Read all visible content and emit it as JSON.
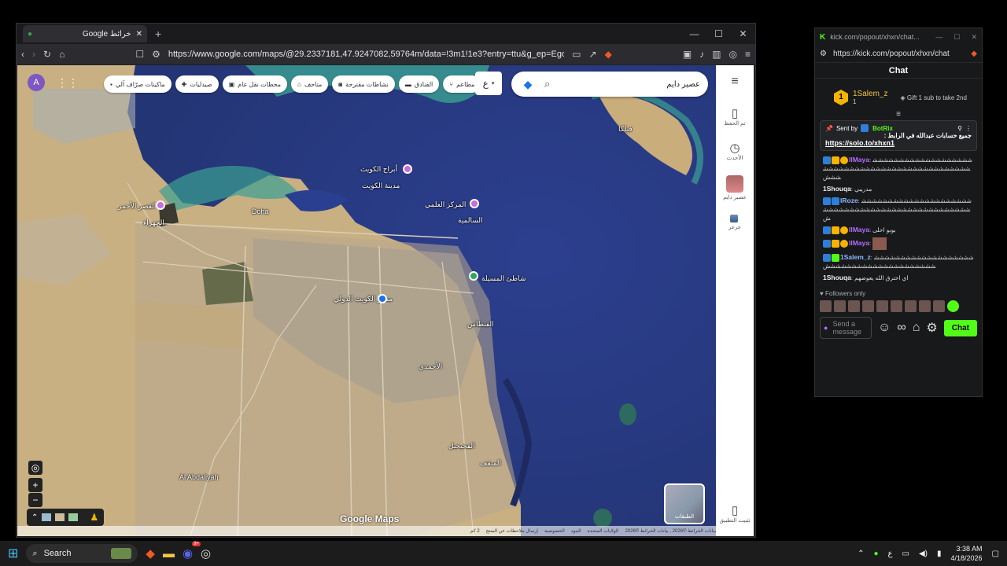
{
  "browser": {
    "tab_title": "Google خرائط",
    "tab_close": "✕",
    "new_tab": "+",
    "win_min": "—",
    "win_max": "☐",
    "win_close": "✕",
    "url": "https://www.google.com/maps/@29.2337181,47.9247082,59764m/data=!3m1!1e3?entry=ttu&g_ep=EgoyMDI2MD..."
  },
  "map": {
    "search_text": "عصير دايم",
    "keyboard_label": "ع",
    "avatar_letter": "A",
    "chips": [
      "مطاعم",
      "الفنادق",
      "نشاطات مقترحة",
      "متاحف",
      "محطات نقل عام",
      "صيدليات",
      "ماكينات صرّاف آلي"
    ],
    "side": {
      "saved": "تم الحفظ",
      "recent": "الأحدث",
      "place1": "عصير دايم",
      "place2": "عرعر",
      "app": "تثبيت التطبيق"
    },
    "layers_label": "الطبقات",
    "logo": "Google Maps",
    "footer": [
      "بيانات الخرائط ©2026 , بيانات الخرائط ©2026",
      "الولايات المتحدة",
      "البنود",
      "الخصوصية",
      "إرسال ملاحظات عن المنتج",
      "2 كم"
    ],
    "labels": {
      "kuwait_towers": "أبراج الكويت",
      "kuwait_city": "مدينة الكويت",
      "scientific": "المركز العلمي",
      "salmiya": "السالمية",
      "messila": "شاطئ المسيلة",
      "red_palace": "القصر الأحمر",
      "jahra": "الجهراء",
      "doha": "Doha",
      "airport": "مطار الكويت الدولي",
      "ahmadi": "الأحمدي",
      "fintas": "الفنطاس",
      "abdaliyah": "Al Abdaliyah",
      "failaka": "فيلكا",
      "fahaheel": "الفحيحيل",
      "mangaf": "المنقف"
    }
  },
  "chat_window": {
    "title_url": "kick.com/popout/xhxn/chat...",
    "url": "https://kick.com/popout/xhxn/chat",
    "header": "Chat",
    "gift_user": "1Salem_z",
    "gift_count": "1",
    "gift_text": "Gift 1 sub to take 2nd",
    "pinned": {
      "sent_by": "Sent by",
      "bot": "BotRix",
      "text": "جميع حسابات عبدالله في الرابط :",
      "link": "https://solo.to/xhxn1"
    },
    "messages": [
      {
        "user": "llMaya",
        "cls": "u-purple",
        "text": "شششششششششششششششششششششششششششششششششششششششششششششششششش"
      },
      {
        "user": "1Shouqa",
        "cls": "u-white",
        "text": "مدريبي"
      },
      {
        "user": "lRoze",
        "cls": "u-blue",
        "text": "شششششششششششششششششششششششششششششششششششششششششششششششششش"
      },
      {
        "user": "llMaya",
        "cls": "u-purple",
        "text": "بوبو احلى"
      },
      {
        "user": "llMaya",
        "cls": "u-purple",
        "text": ""
      },
      {
        "user": "1Salem_z",
        "cls": "u-blue",
        "text": "شششششششششششششششششششششششششششششششششششششششش"
      },
      {
        "user": "1Shouqa",
        "cls": "u-white",
        "text": "اي احترق الله يعوضهم"
      }
    ],
    "followers": "Followers only",
    "input_placeholder": "Send a message",
    "chat_button": "Chat"
  },
  "taskbar": {
    "search": "Search",
    "discord_badge": "9+",
    "time": "3:38 AM",
    "date": "4/18/2026",
    "lang": "ع"
  }
}
